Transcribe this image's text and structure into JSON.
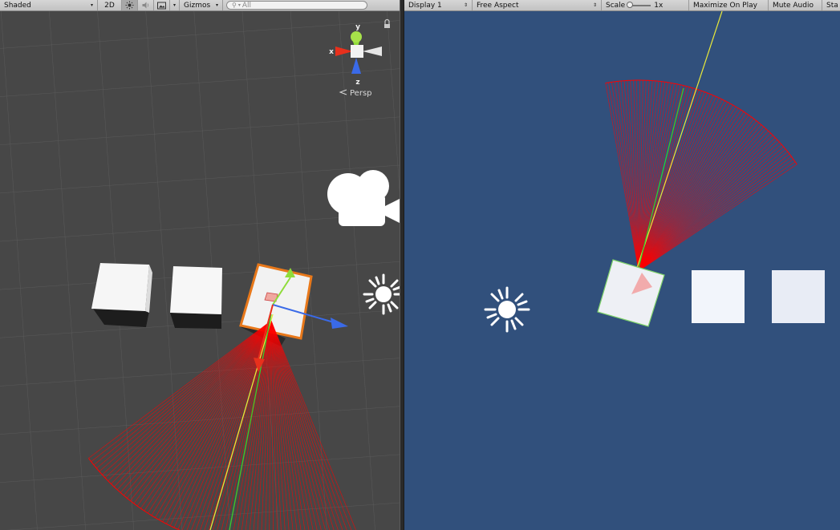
{
  "scene_toolbar": {
    "shading_mode": "Shaded",
    "mode_2d": "2D",
    "gizmos_label": "Gizmos",
    "search_placeholder": "All"
  },
  "game_toolbar": {
    "display": "Display 1",
    "aspect": "Free Aspect",
    "scale_label": "Scale",
    "scale_value": "1x",
    "maximize_on_play": "Maximize On Play",
    "mute_audio": "Mute Audio",
    "stats": "Sta"
  },
  "scene_gizmo": {
    "y_label": "y",
    "x_label": "x",
    "z_label": "z",
    "projection": "Persp"
  },
  "icons": {
    "lighting_toggle": "sun-icon",
    "audio_toggle": "speaker-icon",
    "effects_toggle": "image-icon",
    "scene_camera": "camera-gizmo-icon",
    "scene_light": "directional-light-icon",
    "game_light": "directional-light-icon",
    "gizmo_lock": "lock-icon"
  },
  "colors": {
    "scene_background": "#474747",
    "game_background": "#31507c",
    "selection_outline": "#e8781a",
    "vision_cone": "#ff0000",
    "sight_line_green": "#2fd12f",
    "sight_line_yellow": "#e8e83a",
    "axis_x": "#e8301c",
    "axis_y": "#8fdc3a",
    "axis_z": "#3a6ae8"
  }
}
